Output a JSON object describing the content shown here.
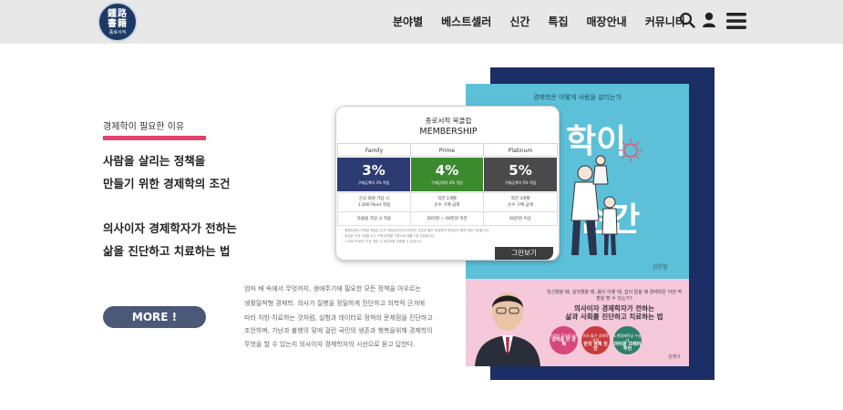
{
  "header": {
    "logo": {
      "line1": "鍾路",
      "line2": "書籍",
      "line3": "종로서적"
    },
    "nav": [
      "분야별",
      "베스트셀러",
      "신간",
      "특집",
      "매장안내",
      "커뮤니티"
    ],
    "icons": [
      "search-icon",
      "user-icon",
      "menu-icon"
    ]
  },
  "intro": {
    "section_title": "경제학이 필요한 이유",
    "headline_lines": [
      "사람을 살리는 정책을",
      "만들기 위한 경제학의 조건",
      "의사이자 경제학자가 전하는",
      "삶을 진단하고 치료하는 법"
    ],
    "more_button": "MORE !",
    "paragraph_lines": [
      "엄마 배 속에서 무엇까지, 생애주기에 필요한 모든 정책을 아우르는",
      "생활밀착형 경제학. 의사가 질병을 정밀하게 진단하고 의학적 근거에",
      "따라 처방·치료하는 것처럼, 실험과 데이터로 정책의 문제점을 진단하고",
      "조언하며, 가난과 불행의 덫에 걸린 국민의 생존과 행복을위해 경제학이",
      "무엇을 할 수 있는지 의사이자 경제학자의 시선으로 묻고 답한다."
    ]
  },
  "book": {
    "cover_subtitle": "경제학은 어떻게 사람을 살리는가",
    "title_fragment_1": "학이",
    "title_fragment_2": "순간",
    "author": "김현철",
    "back_tagline": "임신했을 때, 실직했을 때, 몸이 아플 때, 집이 없을 때 경제학은 어떤 역할을 할 수 있는가?",
    "back_title_1": "의사이자 경제학자가 전하는",
    "back_title_2": "삶과 사회를 진단하고 치료하는 법",
    "badges": [
      {
        "top": "전생의 학과중교수",
        "main": "강의를 한 경제",
        "color": "#d6477a"
      },
      {
        "top": "의사·출신 경제학자의",
        "main": "한국 정책 진단",
        "color": "#c93a3a"
      },
      {
        "top": "노벨경제학상 수상자",
        "main": "마이클 크레머 추천",
        "color": "#2f7f6a"
      }
    ],
    "publisher": "김영사"
  },
  "membership": {
    "heading": "종로서적 북클럽",
    "subheading": "MEMBERSHIP",
    "tiers": [
      {
        "name": "Family",
        "pct": "3%",
        "pct_desc": "구매금액의 3% 적립",
        "color": "#2c3c72",
        "benefit": "신규 회원 가입 시\n1,000 Point 적립",
        "condition": "북클럽 가입 시 적용"
      },
      {
        "name": "Prime",
        "pct": "4%",
        "pct_desc": "구매금액의 4% 적립",
        "color": "#3c8a2e",
        "benefit": "직전 3개월\n순수 구매 금액",
        "condition": "20만원 ~ 60만원 미만"
      },
      {
        "name": "Platinum",
        "pct": "5%",
        "pct_desc": "구매금액의 5% 적립",
        "color": "#4a4a4a",
        "benefit": "직전 3개월\n순수 구매 금액",
        "condition": "60만원 이상"
      }
    ],
    "fine_print": [
      "· 회원님께서 선택한 적립은 도서 적립(온라인/오프라인) 쿠폰과 별도 제공되며 포인트도 중복 적립 가능합니다.",
      "· 등급은 직전 3개월 순수 구매 금액을 기준으로 매월 1일 산정됩니다.",
      "· 1,000 POINT 이상 적립 시 현금처럼 사용할 수 있습니다."
    ],
    "view_button": "그만보기"
  },
  "colors": {
    "header_bg": "#e8e8e8",
    "accent_pink": "#e0426c",
    "more_button_bg": "#4c5878",
    "book_navy": "#1b2e66",
    "book_cyan": "#5cc0d9",
    "book_pink": "#f6c9da"
  }
}
